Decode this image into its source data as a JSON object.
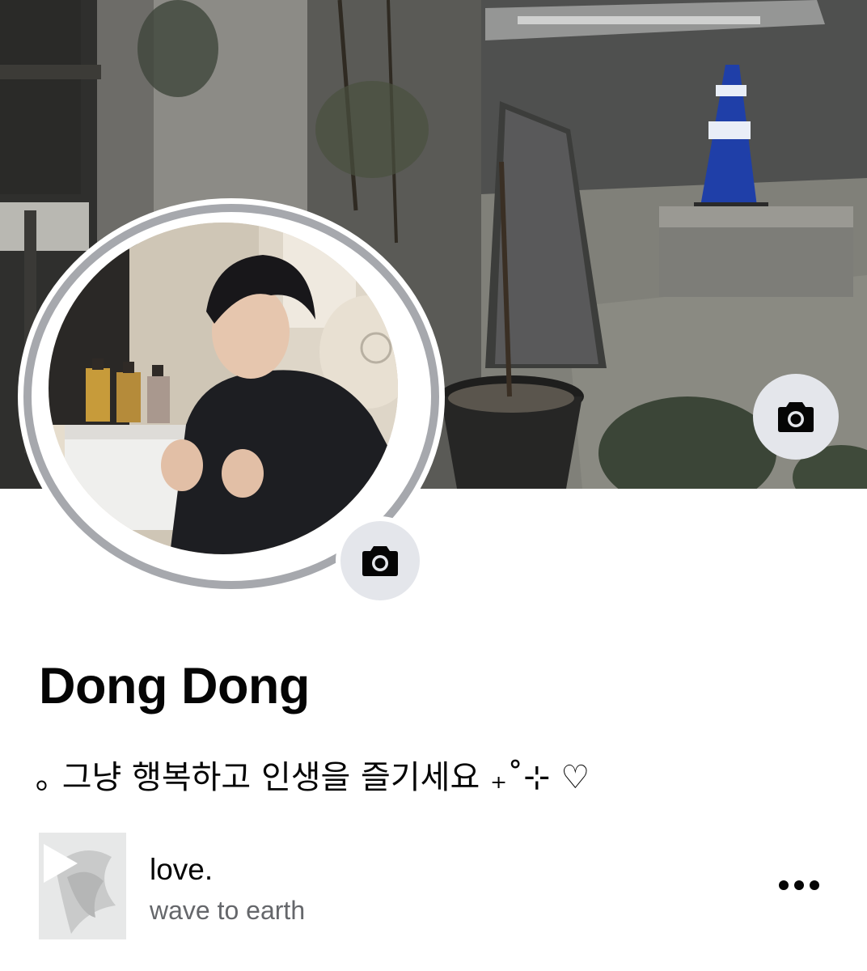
{
  "profile": {
    "name": "Dong Dong",
    "bio": "｡ 그냥 행복하고 인생을 즐기세요 ₊˚⊹ ♡",
    "cover_photo": {
      "description_icon": "cover-photo",
      "camera_icon": "camera-icon"
    },
    "profile_photo": {
      "camera_icon": "camera-icon"
    }
  },
  "music": {
    "song_title": "love.",
    "artist": "wave to earth",
    "play_icon": "play-icon",
    "more_icon": "more-horizontal-icon"
  },
  "colors": {
    "button_bg": "#e4e6eb",
    "ring": "#a6a8ad",
    "secondary_text": "#65676b",
    "primary_text": "#050505"
  }
}
